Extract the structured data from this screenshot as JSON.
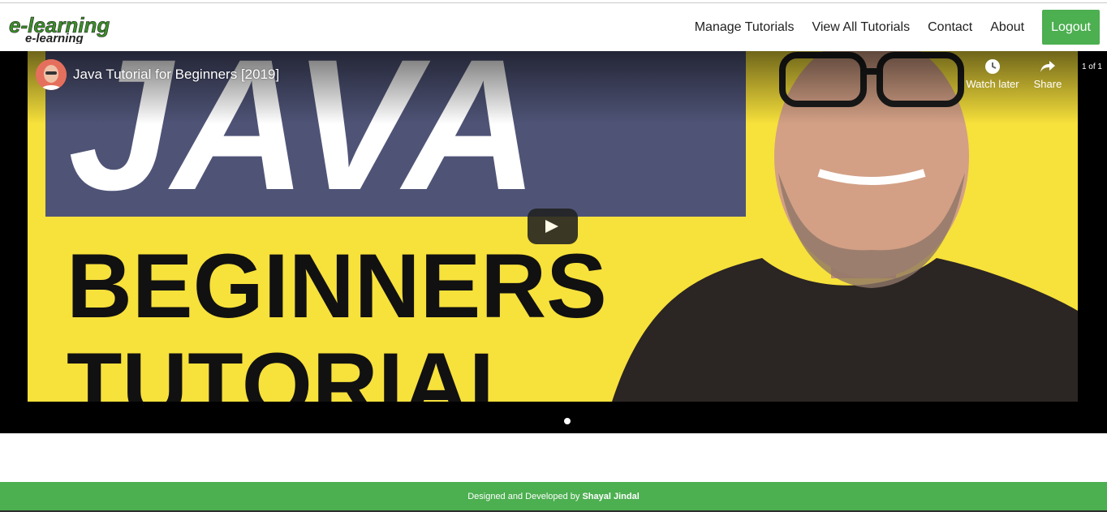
{
  "brand": {
    "logo_text": "e-learning"
  },
  "nav": {
    "items": [
      "Manage Tutorials",
      "View All Tutorials",
      "Contact",
      "About"
    ],
    "logout": "Logout"
  },
  "video": {
    "title": "Java Tutorial for Beginners [2019]",
    "counter": "1 of 1",
    "watch_later": "Watch later",
    "share": "Share",
    "thumbnail_text": {
      "line1": "JAVA",
      "line2": "BEGINNERS",
      "line3": "TUTORIAL"
    }
  },
  "footer": {
    "prefix": "Designed and Developed by",
    "author": "Shayal Jindal"
  },
  "colors": {
    "accent": "#4caf50",
    "thumbnail_yellow": "#f7e13b",
    "thumbnail_banner": "#4f5477"
  }
}
